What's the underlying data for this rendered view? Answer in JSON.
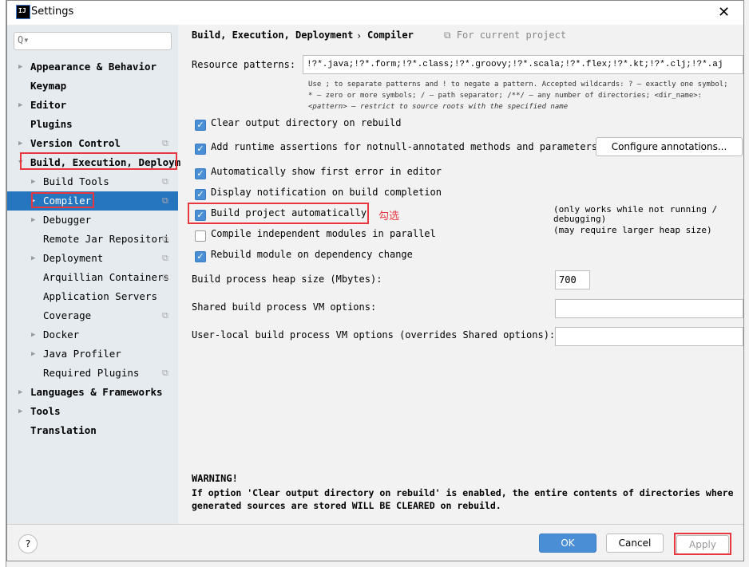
{
  "window": {
    "title": "Settings",
    "close": "✕"
  },
  "search": {
    "placeholder": "Q▾"
  },
  "tree": [
    {
      "label": "Appearance & Behavior",
      "arrow": "▶"
    },
    {
      "label": "Keymap",
      "arrow": ""
    },
    {
      "label": "Editor",
      "arrow": "▶"
    },
    {
      "label": "Plugins",
      "arrow": ""
    },
    {
      "label": "Version Control",
      "arrow": "▶",
      "copy": "⧉"
    },
    {
      "label": "Build, Execution, Deploym",
      "arrow": "▼"
    },
    {
      "label": "Build Tools",
      "arrow": "▶",
      "copy": "⧉"
    },
    {
      "label": "Compiler",
      "arrow": "▶",
      "copy": "⧉"
    },
    {
      "label": "Debugger",
      "arrow": "▶"
    },
    {
      "label": "Remote Jar Repositori",
      "arrow": "",
      "copy": "⧉"
    },
    {
      "label": "Deployment",
      "arrow": "▶",
      "copy": "⧉"
    },
    {
      "label": "Arquillian Containers",
      "arrow": "",
      "copy": "⧉"
    },
    {
      "label": "Application Servers",
      "arrow": ""
    },
    {
      "label": "Coverage",
      "arrow": "",
      "copy": "⧉"
    },
    {
      "label": "Docker",
      "arrow": "▶"
    },
    {
      "label": "Java Profiler",
      "arrow": "▶"
    },
    {
      "label": "Required Plugins",
      "arrow": "",
      "copy": "⧉"
    },
    {
      "label": "Languages & Frameworks",
      "arrow": "▶"
    },
    {
      "label": "Tools",
      "arrow": "▶"
    },
    {
      "label": "Translation",
      "arrow": ""
    }
  ],
  "breadcrumb": {
    "parent": "Build, Execution, Deployment",
    "sep": "›",
    "current": "Compiler",
    "scope": "⧉ For current project"
  },
  "resource": {
    "label": "Resource patterns:",
    "value": "!?*.java;!?*.form;!?*.class;!?*.groovy;!?*.scala;!?*.flex;!?*.kt;!?*.clj;!?*.aj",
    "hint1": "Use ; to separate patterns and ! to negate a pattern. Accepted wildcards: ? — exactly one symbol;",
    "hint2": "* — zero or more symbols; / — path separator; /**/ — any number of directories; <dir_name>:",
    "hint3": "<pattern> — restrict to source roots with the specified name"
  },
  "options": [
    {
      "label": "Clear output directory on rebuild",
      "checked": true
    },
    {
      "label": "Add runtime assertions for notnull-annotated methods and parameters",
      "checked": true
    },
    {
      "label": "Automatically show first error in editor",
      "checked": true
    },
    {
      "label": "Display notification on build completion",
      "checked": true
    },
    {
      "label": "Build project automatically",
      "checked": true,
      "note": "(only works while not running / debugging)"
    },
    {
      "label": "Compile independent modules in parallel",
      "checked": false,
      "note": "(may require larger heap size)"
    },
    {
      "label": "Rebuild module on dependency change",
      "checked": true
    }
  ],
  "configure_button": "Configure annotations...",
  "annotation": "勾选",
  "heap": {
    "label": "Build process heap size (Mbytes):",
    "value": "700"
  },
  "shared_vm": {
    "label": "Shared build process VM options:",
    "value": ""
  },
  "user_vm": {
    "label": "User-local build process VM options (overrides Shared options):",
    "value": ""
  },
  "warning": {
    "title": "WARNING!",
    "line1": "If option 'Clear output directory on rebuild' is enabled, the entire contents of directories where",
    "line2": "generated sources are stored WILL BE CLEARED on rebuild."
  },
  "buttons": {
    "help": "?",
    "ok": "OK",
    "cancel": "Cancel",
    "apply": "Apply"
  },
  "colors": {
    "accent": "#2675bf",
    "highlight": "#e8373f",
    "ok": "#4a8fd6"
  }
}
